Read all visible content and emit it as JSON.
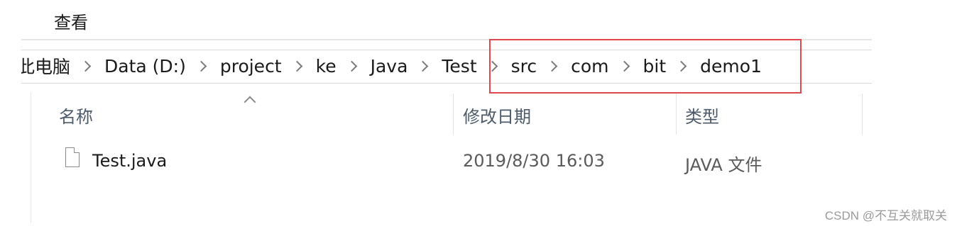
{
  "ribbon": {
    "view_tab": "查看"
  },
  "breadcrumb": {
    "items": [
      "此电脑",
      "Data (D:)",
      "project",
      "ke",
      "Java",
      "Test",
      "src",
      "com",
      "bit",
      "demo1"
    ]
  },
  "columns": {
    "name": "名称",
    "date_modified": "修改日期",
    "type": "类型"
  },
  "files": [
    {
      "name": "Test.java",
      "date_modified": "2019/8/30 16:03",
      "type": "JAVA 文件"
    }
  ],
  "watermark": "CSDN @不互关就取关",
  "colors": {
    "highlight": "#e0474c",
    "header_text": "#4d5a6a"
  },
  "icons": {
    "sort": "chevron-up-icon",
    "separator": "chevron-right-icon",
    "file": "file-icon"
  }
}
